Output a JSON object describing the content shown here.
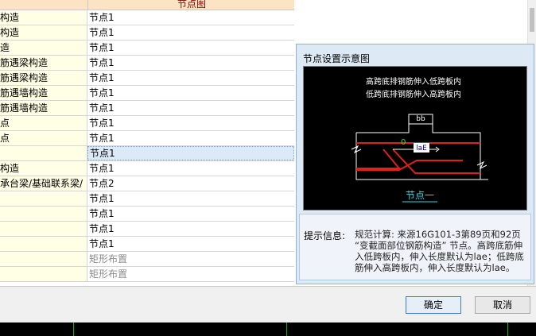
{
  "grid": {
    "column_header": "节点图",
    "rows": [
      {
        "label": "构造",
        "value": "节点1"
      },
      {
        "label": "构造",
        "value": "节点1"
      },
      {
        "label": "造",
        "value": "节点1"
      },
      {
        "label": "筋遇梁构造",
        "value": "节点1"
      },
      {
        "label": "筋遇梁构造",
        "value": "节点1"
      },
      {
        "label": "筋遇墙构造",
        "value": "节点1"
      },
      {
        "label": "筋遇墙构造",
        "value": "节点1"
      },
      {
        "label": "点",
        "value": "节点1"
      },
      {
        "label": "点",
        "value": "节点1"
      },
      {
        "label": "",
        "value": "节点1"
      },
      {
        "label": "构造",
        "value": "节点1"
      },
      {
        "label": "承台梁/基础联系梁/",
        "value": "节点2"
      },
      {
        "label": "",
        "value": "节点1"
      },
      {
        "label": "",
        "value": "节点1"
      },
      {
        "label": "",
        "value": "节点1"
      },
      {
        "label": "",
        "value": "节点1"
      },
      {
        "label": "",
        "value": "矩形布置"
      },
      {
        "label": "",
        "value": "矩形布置"
      }
    ]
  },
  "popup": {
    "title": "节点设置示意图",
    "diagram": {
      "line1": "高跨底排钢筋伸入低跨板内",
      "line2": "低跨底排钢筋伸入高跨板内",
      "dim_label": "bb",
      "zero_label": "0",
      "lae_label": "laE",
      "caption": "节点一"
    },
    "info_label": "提示信息:",
    "info_text": "规范计算: 来源16G101-3第89页和92页 “变截面部位钢筋构造” 节点。高跨底筋伸入低跨板内，伸入长度默认为lae；低跨底筋伸入高跨板内，伸入长度默认为lae。"
  },
  "buttons": {
    "ok": "确定",
    "cancel": "取消"
  },
  "colors": {
    "header_bg": "#fbe3c4",
    "label_col_bg": "#ffffe5",
    "diagram_bg": "#000000",
    "rebar_red": "#e0201a",
    "caption_cyan": "#38d6e8"
  }
}
